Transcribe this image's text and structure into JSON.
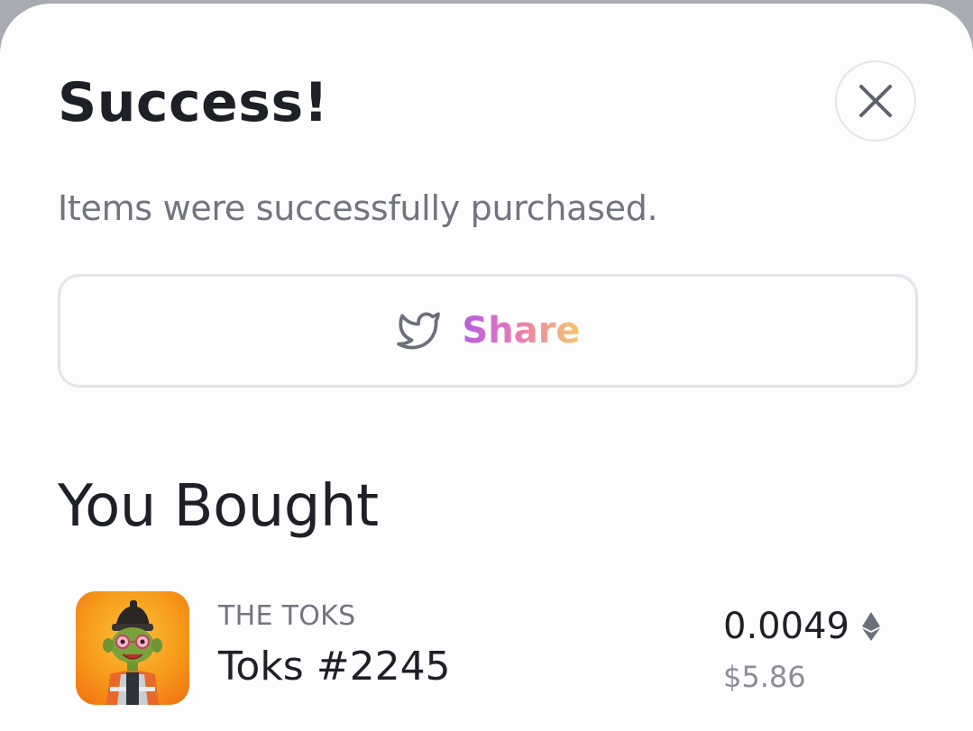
{
  "modal": {
    "title": "Success!",
    "subtitle": "Items were successfully purchased.",
    "close_icon": "close-icon"
  },
  "share": {
    "label": "Share",
    "icon": "twitter-bird-icon"
  },
  "purchase": {
    "heading": "You Bought",
    "items": [
      {
        "collection": "THE TOKS",
        "name": "Toks #2245",
        "price_eth": "0.0049",
        "price_usd": "$5.86",
        "currency_icon": "ethereum-icon"
      }
    ]
  },
  "colors": {
    "title": "#1e2027",
    "muted": "#71757f",
    "border": "#e3e5ea",
    "share_gradient": [
      "#b65ee0",
      "#e978b6",
      "#f6c86c"
    ]
  }
}
